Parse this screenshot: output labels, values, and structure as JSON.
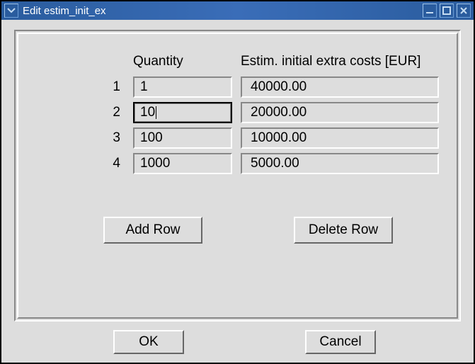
{
  "window": {
    "title": "Edit estim_init_ex"
  },
  "table": {
    "headers": {
      "quantity": "Quantity",
      "cost": "Estim. initial extra costs [EUR]"
    },
    "rows": [
      {
        "n": "1",
        "quantity": "1",
        "cost": "40000.00"
      },
      {
        "n": "2",
        "quantity": "10",
        "cost": "20000.00"
      },
      {
        "n": "3",
        "quantity": "100",
        "cost": "10000.00"
      },
      {
        "n": "4",
        "quantity": "1000",
        "cost": " 5000.00"
      }
    ],
    "active_row_index": 1
  },
  "buttons": {
    "add_row": "Add Row",
    "delete_row": "Delete Row",
    "ok": "OK",
    "cancel": "Cancel"
  }
}
